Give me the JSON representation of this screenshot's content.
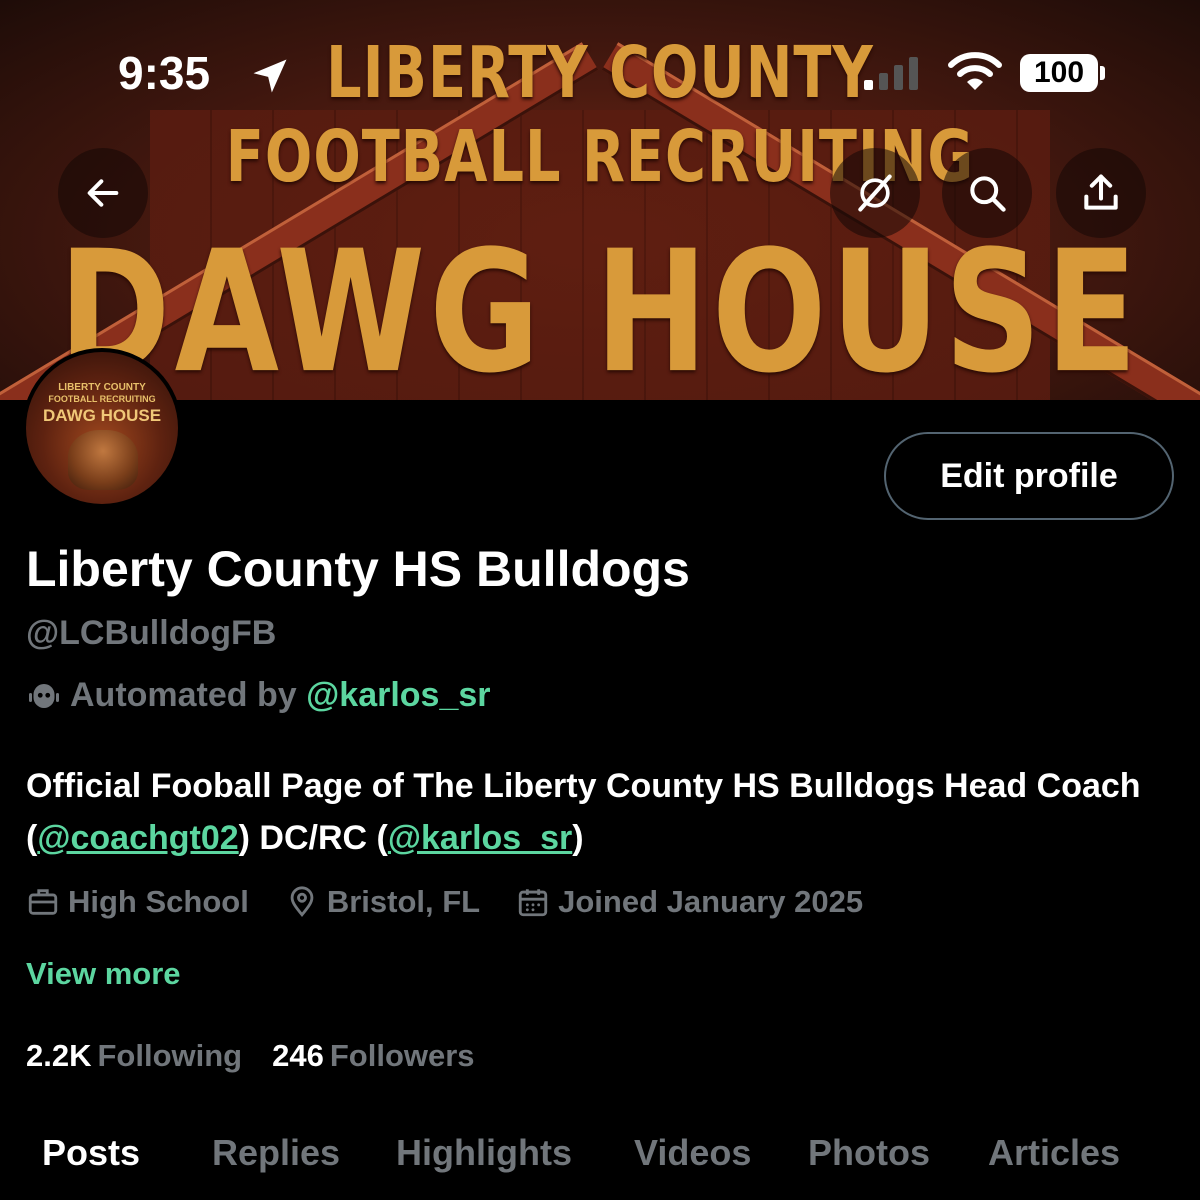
{
  "status_bar": {
    "time": "9:35",
    "battery": "100"
  },
  "banner": {
    "line1": "LIBERTY COUNTY",
    "line2": "FOOTBALL RECRUITING",
    "line3": "DAWG HOUSE"
  },
  "avatar": {
    "line1": "LIBERTY COUNTY",
    "line2": "FOOTBALL RECRUITING",
    "line3": "DAWG HOUSE"
  },
  "header": {
    "edit_label": "Edit profile"
  },
  "profile": {
    "name": "Liberty County HS Bulldogs",
    "handle": "@LCBulldogFB",
    "automated_prefix": "Automated by",
    "automated_by": "@karlos_sr",
    "bio": {
      "text1": "Official Fooball Page of The Liberty County HS Bulldogs Head Coach (",
      "link1": "@coachgt02",
      "text2": ") DC/RC (",
      "link2": "@karlos_sr",
      "text3": ")"
    },
    "category": "High School",
    "location": "Bristol, FL",
    "joined": "Joined January 2025",
    "view_more": "View more",
    "following_count": "2.2K",
    "following_label": "Following",
    "followers_count": "246",
    "followers_label": "Followers"
  },
  "tabs": [
    "Posts",
    "Replies",
    "Highlights",
    "Videos",
    "Photos",
    "Articles"
  ],
  "colors": {
    "accent": "#5cd6a0",
    "muted": "#71767b",
    "background": "#000000"
  }
}
